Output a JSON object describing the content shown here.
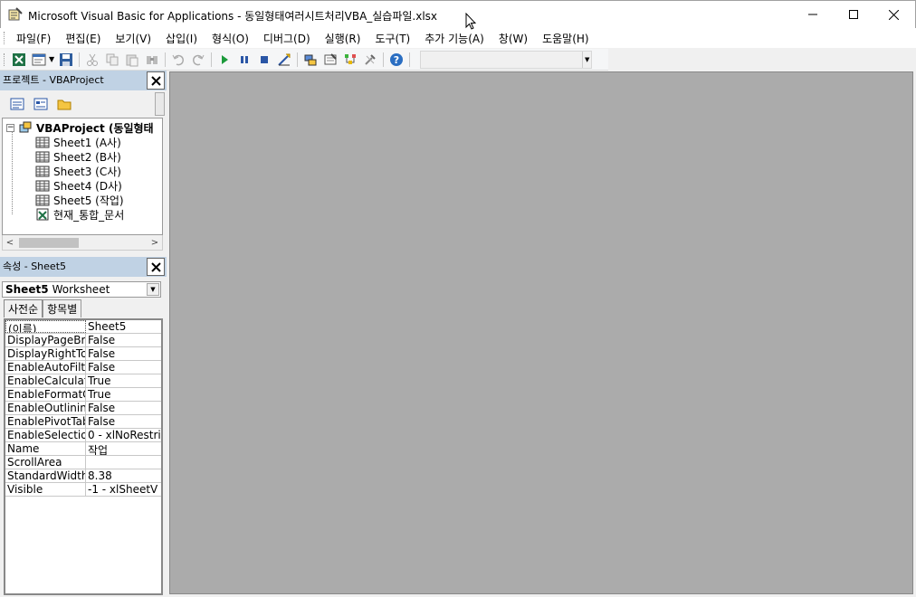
{
  "window": {
    "title": "Microsoft Visual Basic for Applications - 동일형태여러시트처리VBA_실습파일.xlsx",
    "app_icon": "vba-app-icon",
    "controls": [
      "minimize-icon",
      "maximize-icon",
      "close-icon"
    ]
  },
  "menubar": {
    "items": [
      {
        "label": "파일(F)"
      },
      {
        "label": "편집(E)"
      },
      {
        "label": "보기(V)"
      },
      {
        "label": "삽입(I)"
      },
      {
        "label": "형식(O)"
      },
      {
        "label": "디버그(D)"
      },
      {
        "label": "실행(R)"
      },
      {
        "label": "도구(T)"
      },
      {
        "label": "추가 기능(A)"
      },
      {
        "label": "창(W)"
      },
      {
        "label": "도움말(H)"
      }
    ]
  },
  "toolbar": {
    "buttons": [
      "excel-icon",
      "insert-module-icon",
      "save-icon",
      "cut-icon",
      "copy-icon",
      "paste-icon",
      "find-icon",
      "undo-icon",
      "redo-icon",
      "run-icon",
      "break-icon",
      "reset-icon",
      "design-mode-icon",
      "project-explorer-icon",
      "properties-icon",
      "object-browser-icon",
      "toolbox-icon",
      "help-icon"
    ]
  },
  "project_panel": {
    "title": "프로젝트 - VBAProject",
    "root": "VBAProject (동일형태",
    "items": [
      {
        "label": "Sheet1 (A사)"
      },
      {
        "label": "Sheet2 (B사)"
      },
      {
        "label": "Sheet3 (C사)"
      },
      {
        "label": "Sheet4 (D사)"
      },
      {
        "label": "Sheet5 (작업)"
      },
      {
        "label": "현재_통합_문서"
      }
    ]
  },
  "properties_panel": {
    "title": "속성 - Sheet5",
    "object_name": "Sheet5",
    "object_type": "Worksheet",
    "tabs": [
      {
        "label": "사전순"
      },
      {
        "label": "항목별"
      }
    ],
    "rows": [
      {
        "name": "(이름)",
        "value": "Sheet5"
      },
      {
        "name": "DisplayPageBre",
        "value": "False"
      },
      {
        "name": "DisplayRightTo",
        "value": "False"
      },
      {
        "name": "EnableAutoFilte",
        "value": "False"
      },
      {
        "name": "EnableCalculat",
        "value": "True"
      },
      {
        "name": "EnableFormatC",
        "value": "True"
      },
      {
        "name": "EnableOutlining",
        "value": "False"
      },
      {
        "name": "EnablePivotTab",
        "value": "False"
      },
      {
        "name": "EnableSelectio",
        "value": "0 - xlNoRestri"
      },
      {
        "name": "Name",
        "value": "작업"
      },
      {
        "name": "ScrollArea",
        "value": ""
      },
      {
        "name": "StandardWidth",
        "value": "8.38"
      },
      {
        "name": "Visible",
        "value": "-1 - xlSheetV"
      }
    ]
  },
  "colors": {
    "panel_header": "#c0d2e4",
    "workspace": "#ababab"
  }
}
